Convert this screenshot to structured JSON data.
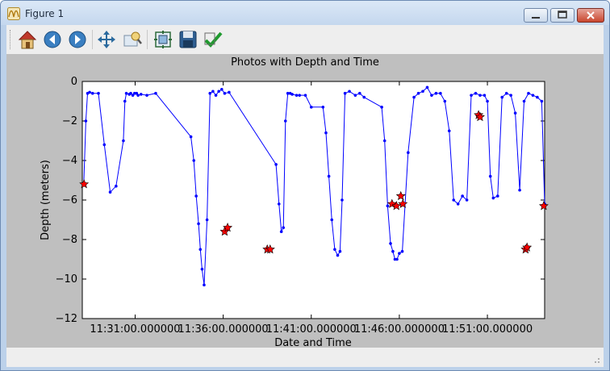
{
  "window": {
    "title": "Figure 1"
  },
  "toolbar": {
    "buttons": [
      {
        "name": "home-button",
        "icon": "home-icon"
      },
      {
        "name": "back-button",
        "icon": "arrow-left-icon"
      },
      {
        "name": "forward-button",
        "icon": "arrow-right-icon"
      },
      {
        "name": "pan-button",
        "icon": "move-arrows-icon"
      },
      {
        "name": "zoom-button",
        "icon": "zoom-rect-icon"
      },
      {
        "name": "subplots-button",
        "icon": "subplots-icon"
      },
      {
        "name": "save-button",
        "icon": "floppy-disk-icon"
      },
      {
        "name": "edit-button",
        "icon": "checkmark-icon"
      }
    ]
  },
  "colors": {
    "line": "#0000ff",
    "marker": "#ff0000",
    "figure_bg": "#bfbfbf",
    "axes_bg": "#ffffff"
  },
  "chart_data": {
    "type": "line",
    "title": "Photos with Depth and Time",
    "xlabel": "Date and Time",
    "ylabel": "Depth (meters)",
    "x_unit": "time of day",
    "xlim": [
      "11:28:00",
      "11:54:15"
    ],
    "ylim": [
      -12,
      0
    ],
    "xticks": [
      "11:31:00.000000",
      "11:36:00.000000",
      "11:41:00.000000",
      "11:46:00.000000",
      "11:51:00.000000"
    ],
    "yticks": [
      "0",
      "−2",
      "−4",
      "−6",
      "−8",
      "−10",
      "−12"
    ],
    "ytick_values": [
      0,
      -2,
      -4,
      -6,
      -8,
      -10,
      -12
    ],
    "grid": false,
    "series": [
      {
        "style": "blue line with dot markers",
        "x": [
          "11:28:05",
          "11:28:12",
          "11:28:18",
          "11:28:25",
          "11:28:35",
          "11:28:55",
          "11:29:15",
          "11:29:35",
          "11:29:55",
          "11:30:20",
          "11:30:25",
          "11:30:30",
          "11:30:40",
          "11:30:45",
          "11:30:52",
          "11:30:58",
          "11:31:05",
          "11:31:10",
          "11:31:20",
          "11:31:40",
          "11:32:10",
          "11:34:10",
          "11:34:20",
          "11:34:28",
          "11:34:36",
          "11:34:42",
          "11:34:48",
          "11:34:55",
          "11:35:05",
          "11:35:15",
          "11:35:25",
          "11:35:35",
          "11:35:45",
          "11:35:55",
          "11:36:05",
          "11:36:20",
          "11:39:00",
          "11:39:10",
          "11:39:18",
          "11:39:25",
          "11:39:32",
          "11:39:40",
          "11:39:48",
          "11:39:55",
          "11:40:10",
          "11:40:20",
          "11:40:40",
          "11:41:00",
          "11:41:40",
          "11:41:50",
          "11:42:00",
          "11:42:10",
          "11:42:20",
          "11:42:30",
          "11:42:38",
          "11:42:45",
          "11:42:55",
          "11:43:10",
          "11:43:30",
          "11:43:45",
          "11:44:00",
          "11:45:00",
          "11:45:10",
          "11:45:20",
          "11:45:30",
          "11:45:38",
          "11:45:45",
          "11:45:52",
          "11:46:00",
          "11:46:10",
          "11:46:30",
          "11:46:50",
          "11:47:05",
          "11:47:20",
          "11:47:35",
          "11:47:50",
          "11:48:05",
          "11:48:20",
          "11:48:35",
          "11:48:50",
          "11:49:05",
          "11:49:20",
          "11:49:35",
          "11:49:50",
          "11:50:05",
          "11:50:20",
          "11:50:35",
          "11:50:50",
          "11:51:00",
          "11:51:10",
          "11:51:20",
          "11:51:35",
          "11:51:50",
          "11:52:05",
          "11:52:20",
          "11:52:35",
          "11:52:50",
          "11:53:05",
          "11:53:20",
          "11:53:35",
          "11:53:50",
          "11:54:05",
          "11:54:15"
        ],
        "y": [
          -5.2,
          -2.0,
          -0.6,
          -0.55,
          -0.6,
          -0.6,
          -3.2,
          -5.6,
          -5.3,
          -3.0,
          -1.0,
          -0.6,
          -0.65,
          -0.6,
          -0.7,
          -0.6,
          -0.6,
          -0.7,
          -0.65,
          -0.7,
          -0.6,
          -2.8,
          -4.0,
          -5.8,
          -7.2,
          -8.5,
          -9.5,
          -10.3,
          -7.0,
          -0.6,
          -0.5,
          -0.7,
          -0.5,
          -0.4,
          -0.6,
          -0.55,
          -4.2,
          -6.2,
          -7.6,
          -7.4,
          -2.0,
          -0.6,
          -0.6,
          -0.65,
          -0.7,
          -0.7,
          -0.7,
          -1.3,
          -1.3,
          -2.6,
          -4.8,
          -7.0,
          -8.5,
          -8.8,
          -8.6,
          -6.0,
          -0.6,
          -0.5,
          -0.7,
          -0.6,
          -0.8,
          -1.3,
          -3.0,
          -6.3,
          -8.2,
          -8.6,
          -9.0,
          -9.0,
          -8.7,
          -8.6,
          -3.6,
          -0.8,
          -0.6,
          -0.5,
          -0.3,
          -0.7,
          -0.6,
          -0.6,
          -1.0,
          -2.5,
          -6.0,
          -6.2,
          -5.8,
          -6.0,
          -0.7,
          -0.6,
          -0.7,
          -0.7,
          -1.0,
          -4.8,
          -5.9,
          -5.8,
          -0.8,
          -0.6,
          -0.7,
          -1.6,
          -5.5,
          -1.0,
          -0.6,
          -0.7,
          -0.8,
          -1.0,
          -6.2
        ],
        "markers": "dots"
      },
      {
        "style": "red star markers",
        "x": [
          "11:28:06",
          "11:36:05",
          "11:36:15",
          "11:38:30",
          "11:38:40",
          "11:45:35",
          "11:45:50",
          "11:46:12",
          "11:46:05",
          "11:50:30",
          "11:50:35",
          "11:53:10",
          "11:53:15",
          "11:54:12"
        ],
        "y": [
          -5.2,
          -7.6,
          -7.4,
          -8.5,
          -8.5,
          -6.2,
          -6.3,
          -6.2,
          -5.8,
          -1.7,
          -1.8,
          -8.5,
          -8.4,
          -6.3
        ],
        "markers": "stars"
      }
    ]
  }
}
